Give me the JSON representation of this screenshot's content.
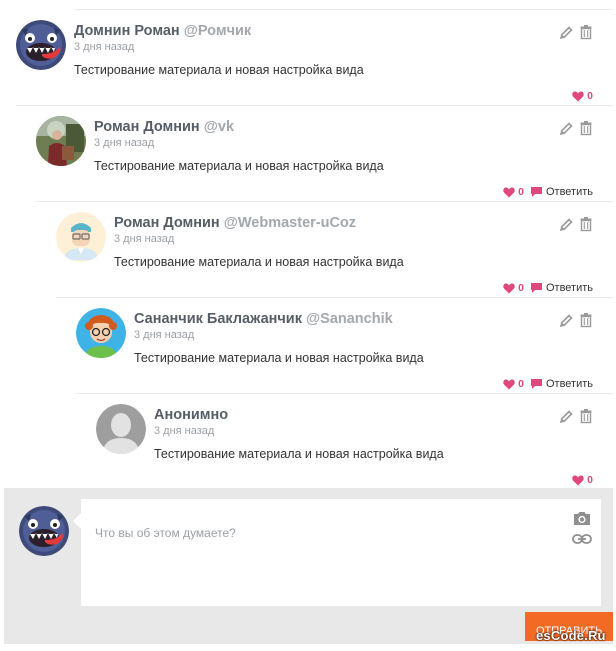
{
  "comments": [
    {
      "author": "Домнин Роман",
      "handle": "@Ромчик",
      "time": "3 дня назад",
      "text": "Тестирование материала и новая настройка вида",
      "likes": "0",
      "reply": ""
    },
    {
      "author": "Роман Домнин",
      "handle": "@vk",
      "time": "3 дня назад",
      "text": "Тестирование материала и новая настройка вида",
      "likes": "0",
      "reply": "Ответить"
    },
    {
      "author": "Роман Домнин",
      "handle": "@Webmaster-uCoz",
      "time": "3 дня назад",
      "text": "Тестирование материала и новая настройка вида",
      "likes": "0",
      "reply": "Ответить"
    },
    {
      "author": "Сананчик Баклажанчик",
      "handle": "@Sananchik",
      "time": "3 дня назад",
      "text": "Тестирование материала и новая настройка вида",
      "likes": "0",
      "reply": "Ответить"
    },
    {
      "author": "Анонимно",
      "handle": "",
      "time": "3 дня назад",
      "text": "Тестирование материала и новая настройка вида",
      "likes": "0",
      "reply": ""
    }
  ],
  "composer": {
    "placeholder": "Что вы об этом думаете?",
    "send_label": "ОТПРАВИТЬ"
  },
  "watermark": "esCode.Ru",
  "colors": {
    "accent": "#f26a24",
    "heart": "#e0477a",
    "bg_gray": "#e8e8e8"
  }
}
